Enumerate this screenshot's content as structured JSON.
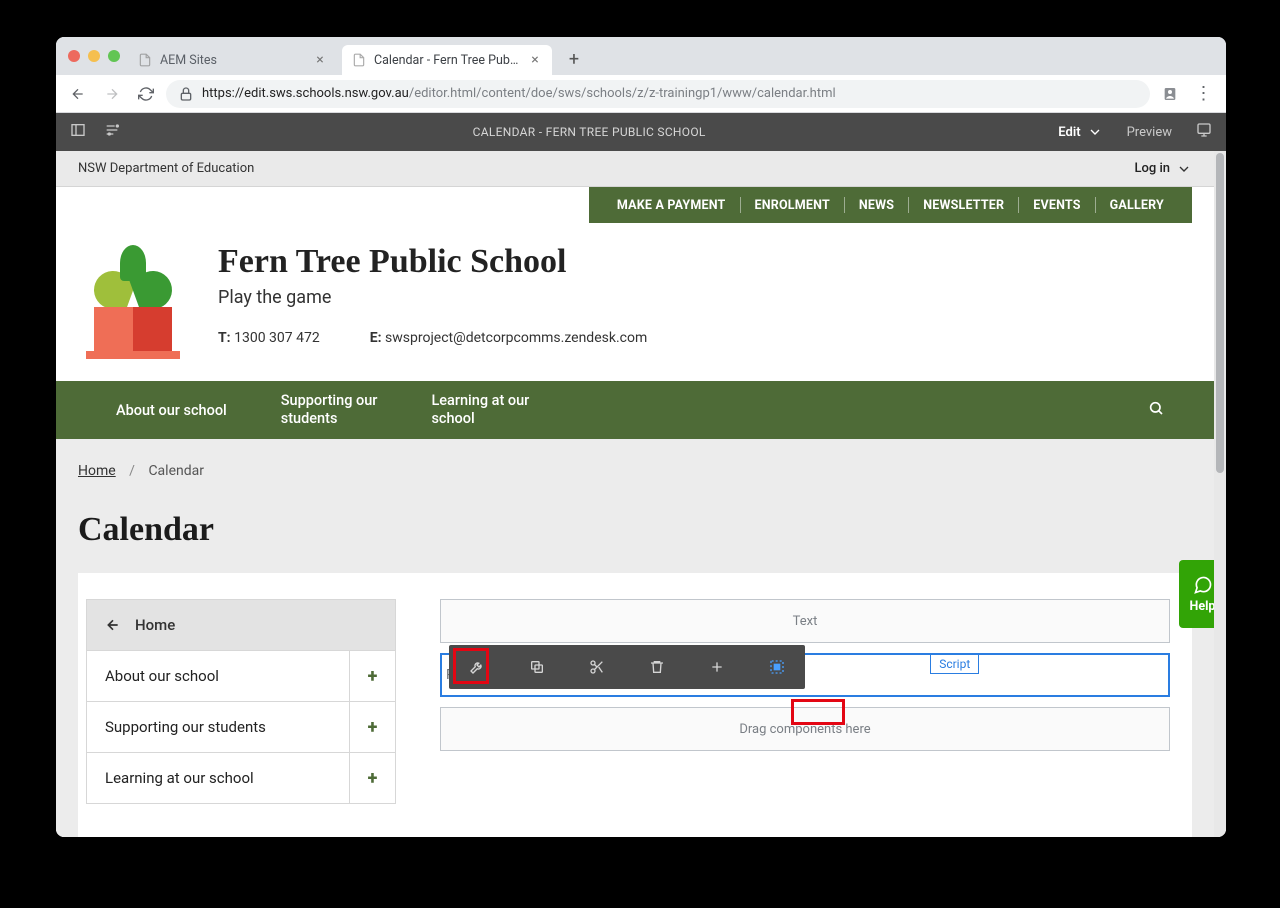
{
  "browser": {
    "tabs": [
      {
        "label": "AEM Sites",
        "active": false
      },
      {
        "label": "Calendar - Fern Tree Public Sc",
        "active": true
      }
    ],
    "url_secure_domain": "https://edit.sws.schools.nsw.gov.au",
    "url_path": "/editor.html/content/doe/sws/schools/z/z-trainingp1/www/calendar.html"
  },
  "aem": {
    "title": "CALENDAR - FERN TREE PUBLIC SCHOOL",
    "edit_label": "Edit",
    "preview_label": "Preview"
  },
  "dept_bar": {
    "dept": "NSW Department of Education",
    "login_label": "Log in"
  },
  "util_nav": {
    "items": [
      "MAKE A PAYMENT",
      "ENROLMENT",
      "NEWS",
      "NEWSLETTER",
      "EVENTS",
      "GALLERY"
    ]
  },
  "school": {
    "name": "Fern Tree Public School",
    "tagline": "Play the game",
    "phone_label": "T:",
    "phone": " 1300 307 472",
    "email_label": "E:",
    "email": " swsproject@detcorpcomms.zendesk.com"
  },
  "primary_nav": {
    "items": [
      "About our school",
      "Supporting our\nstudents",
      "Learning at our\nschool"
    ]
  },
  "breadcrumb": {
    "home": "Home",
    "current": "Calendar"
  },
  "page": {
    "title": "Calendar"
  },
  "sidebar": {
    "home": "Home",
    "items": [
      "About our school",
      "Supporting our students",
      "Learning at our school"
    ],
    "expand": "+"
  },
  "components": {
    "text_placeholder": "Text",
    "script_placeholder": "Please enter your script, or delete this Script component",
    "script_tag": "Script",
    "drop_placeholder": "Drag components here"
  },
  "help": {
    "label": "Help"
  }
}
